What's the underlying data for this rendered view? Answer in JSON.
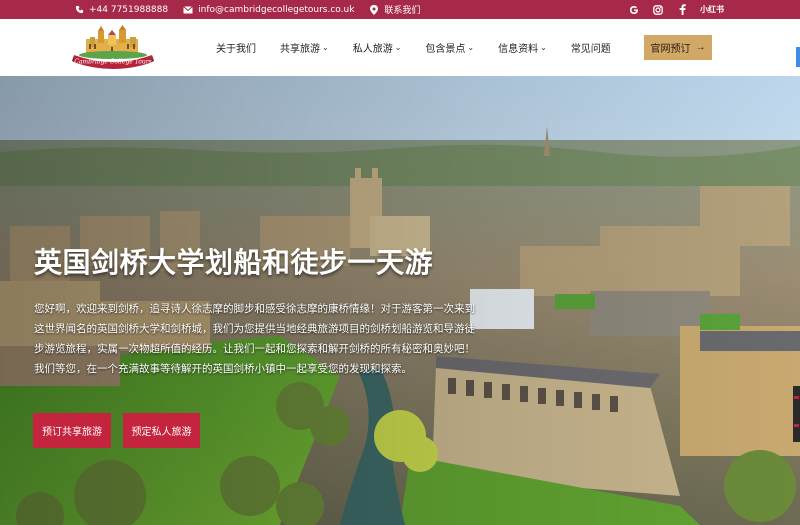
{
  "topbar": {
    "phone": "+44 7751988888",
    "email": "info@cambridgecollegetours.co.uk",
    "contact": "联系我们",
    "social": [
      "google-icon",
      "instagram-icon",
      "facebook-icon",
      "xiaohongshu"
    ],
    "xiaohongshu_label": "小红书",
    "bg_color": "#a7294a"
  },
  "header": {
    "logo_text": "Cambridge College Tours",
    "nav": [
      {
        "label": "关于我们",
        "dropdown": false
      },
      {
        "label": "共享旅游",
        "dropdown": true
      },
      {
        "label": "私人旅游",
        "dropdown": true
      },
      {
        "label": "包含景点",
        "dropdown": true
      },
      {
        "label": "信息资料",
        "dropdown": true
      },
      {
        "label": "常见问题",
        "dropdown": false
      }
    ],
    "book_button": "官网预订",
    "book_arrow": "→",
    "chevron": "⌄"
  },
  "hero": {
    "title": "英国剑桥大学划船和徒步一天游",
    "text": "您好啊，欢迎来到剑桥，追寻诗人徐志摩的脚步和感受徐志摩的康桥情缘！对于游客第一次来到这世界闻名的英国剑桥大学和剑桥城，我们为您提供当地经典旅游项目的剑桥划船游览和导游徒步游览旅程，实属一次物超所值的经历。让我们一起和您探索和解开剑桥的所有秘密和奥妙吧！我们等您，在一个充满故事等待解开的英国剑桥小镇中一起享受您的发现和探索。",
    "cta_shared": "预订共享旅游",
    "cta_private": "预定私人旅游"
  },
  "colors": {
    "primary": "#c5243f",
    "gold": "#d2a867"
  }
}
